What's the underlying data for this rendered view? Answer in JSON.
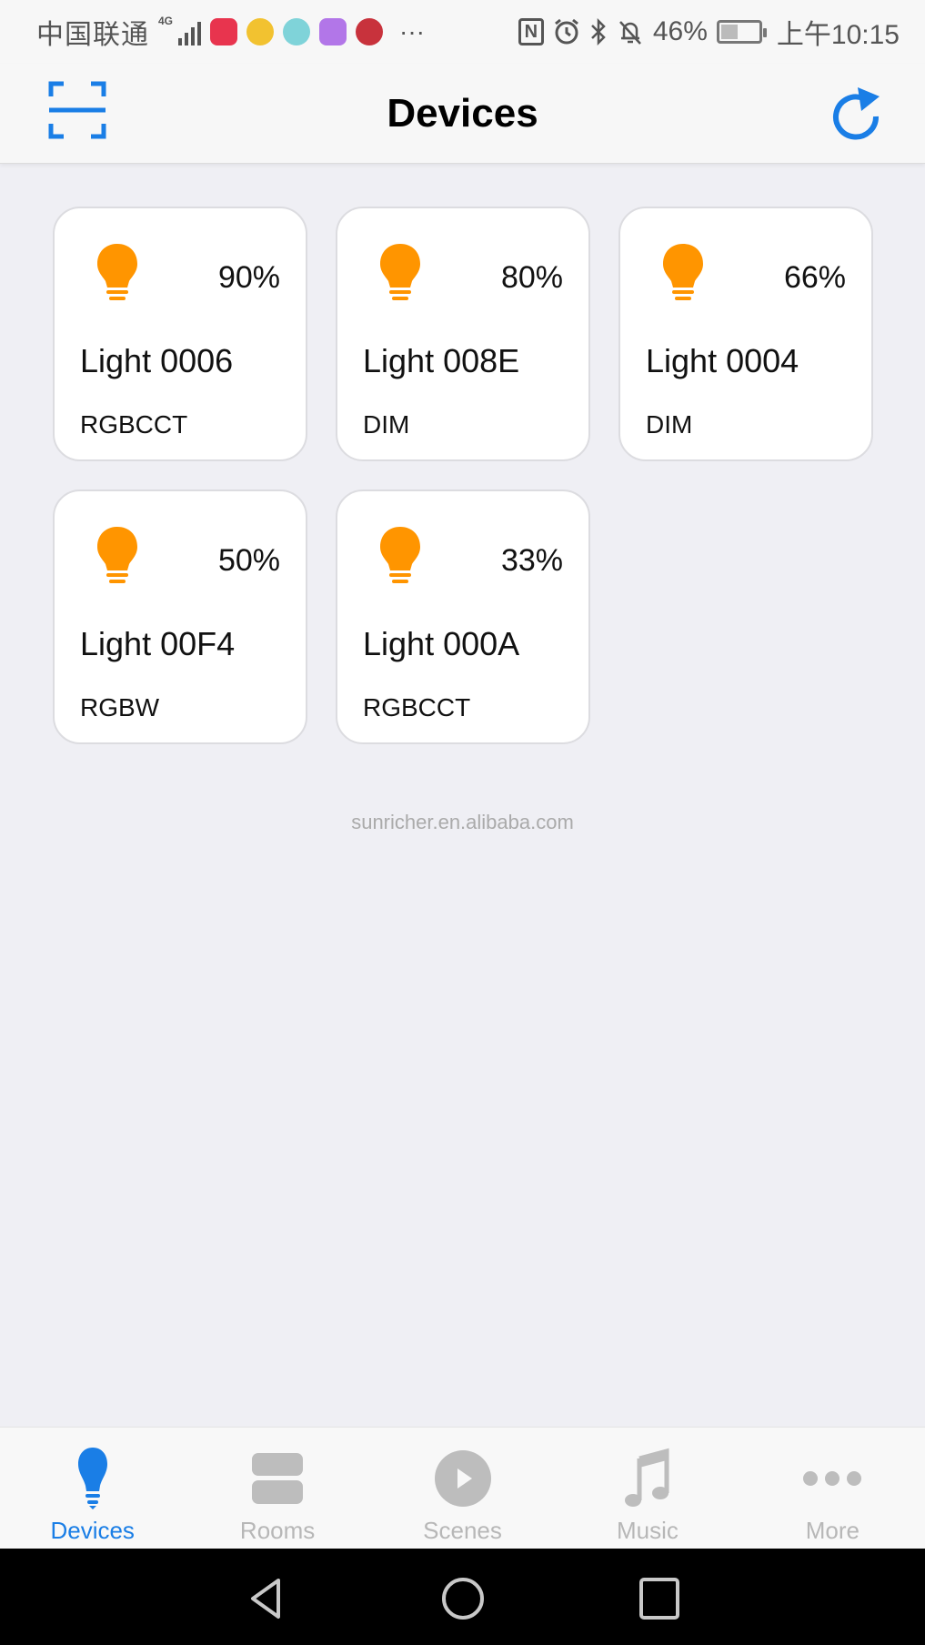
{
  "status_bar": {
    "carrier": "中国联通",
    "network": "4G",
    "more_indicator": "···",
    "battery_percent": "46%",
    "battery_level": 0.46,
    "time": "上午10:15",
    "app_icon_colors": [
      "#e8344e",
      "#f2c230",
      "#7fd3d9",
      "#b276e8",
      "#c8323c"
    ]
  },
  "header": {
    "title": "Devices",
    "accent_color": "#1a7ee6"
  },
  "devices": [
    {
      "level": "90%",
      "name": "Light 0006",
      "type": "RGBCCT"
    },
    {
      "level": "80%",
      "name": "Light 008E",
      "type": "DIM"
    },
    {
      "level": "66%",
      "name": "Light 0004",
      "type": "DIM"
    },
    {
      "level": "50%",
      "name": "Light 00F4",
      "type": "RGBW"
    },
    {
      "level": "33%",
      "name": "Light 000A",
      "type": "RGBCCT"
    }
  ],
  "bulb_color": "#ff9500",
  "watermark": "sunricher.en.alibaba.com",
  "tabs": [
    {
      "label": "Devices",
      "icon": "bulb-icon",
      "active": true
    },
    {
      "label": "Rooms",
      "icon": "rooms-icon",
      "active": false
    },
    {
      "label": "Scenes",
      "icon": "play-circle-icon",
      "active": false
    },
    {
      "label": "Music",
      "icon": "music-note-icon",
      "active": false
    },
    {
      "label": "More",
      "icon": "more-dots-icon",
      "active": false
    }
  ]
}
